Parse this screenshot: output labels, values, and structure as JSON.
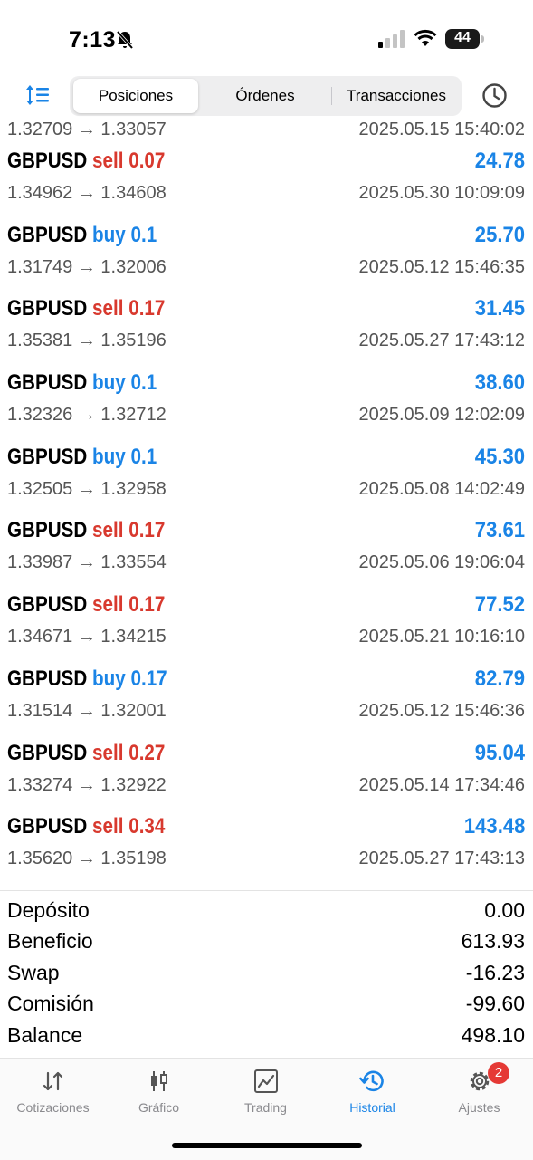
{
  "status_bar": {
    "time": "7:13",
    "battery": "44"
  },
  "topnav": {
    "tabs": [
      "Posiciones",
      "Órdenes",
      "Transacciones"
    ],
    "active_tab": 0
  },
  "first_row": {
    "open": "1.32709",
    "close": "1.33057",
    "datetime": "2025.05.15 15:40:02"
  },
  "trades": [
    {
      "symbol": "GBPUSD",
      "direction": "sell",
      "volume": "0.07",
      "profit": "24.78",
      "open": "1.34962",
      "close": "1.34608",
      "datetime": "2025.05.30 10:09:09"
    },
    {
      "symbol": "GBPUSD",
      "direction": "buy",
      "volume": "0.1",
      "profit": "25.70",
      "open": "1.31749",
      "close": "1.32006",
      "datetime": "2025.05.12 15:46:35"
    },
    {
      "symbol": "GBPUSD",
      "direction": "sell",
      "volume": "0.17",
      "profit": "31.45",
      "open": "1.35381",
      "close": "1.35196",
      "datetime": "2025.05.27 17:43:12"
    },
    {
      "symbol": "GBPUSD",
      "direction": "buy",
      "volume": "0.1",
      "profit": "38.60",
      "open": "1.32326",
      "close": "1.32712",
      "datetime": "2025.05.09 12:02:09"
    },
    {
      "symbol": "GBPUSD",
      "direction": "buy",
      "volume": "0.1",
      "profit": "45.30",
      "open": "1.32505",
      "close": "1.32958",
      "datetime": "2025.05.08 14:02:49"
    },
    {
      "symbol": "GBPUSD",
      "direction": "sell",
      "volume": "0.17",
      "profit": "73.61",
      "open": "1.33987",
      "close": "1.33554",
      "datetime": "2025.05.06 19:06:04"
    },
    {
      "symbol": "GBPUSD",
      "direction": "sell",
      "volume": "0.17",
      "profit": "77.52",
      "open": "1.34671",
      "close": "1.34215",
      "datetime": "2025.05.21 10:16:10"
    },
    {
      "symbol": "GBPUSD",
      "direction": "buy",
      "volume": "0.17",
      "profit": "82.79",
      "open": "1.31514",
      "close": "1.32001",
      "datetime": "2025.05.12 15:46:36"
    },
    {
      "symbol": "GBPUSD",
      "direction": "sell",
      "volume": "0.27",
      "profit": "95.04",
      "open": "1.33274",
      "close": "1.32922",
      "datetime": "2025.05.14 17:34:46"
    },
    {
      "symbol": "GBPUSD",
      "direction": "sell",
      "volume": "0.34",
      "profit": "143.48",
      "open": "1.35620",
      "close": "1.35198",
      "datetime": "2025.05.27 17:43:13"
    }
  ],
  "summary": [
    {
      "label": "Depósito",
      "value": "0.00"
    },
    {
      "label": "Beneficio",
      "value": "613.93"
    },
    {
      "label": "Swap",
      "value": "-16.23"
    },
    {
      "label": "Comisión",
      "value": "-99.60"
    },
    {
      "label": "Balance",
      "value": "498.10"
    }
  ],
  "tabbar": {
    "items": [
      {
        "label": "Cotizaciones",
        "icon": "quotes-icon"
      },
      {
        "label": "Gráfico",
        "icon": "chart-icon"
      },
      {
        "label": "Trading",
        "icon": "trading-icon"
      },
      {
        "label": "Historial",
        "icon": "history-icon"
      },
      {
        "label": "Ajustes",
        "icon": "settings-icon",
        "badge": "2"
      }
    ],
    "active": 3
  },
  "colors": {
    "accent": "#1a84e6",
    "sell": "#d8392e",
    "buy": "#1a84e6",
    "badge": "#e53935"
  }
}
